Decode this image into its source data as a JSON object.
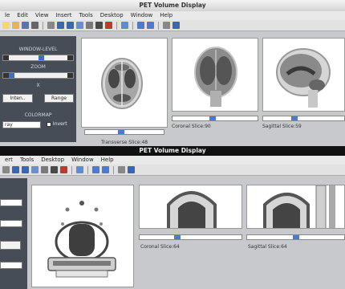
{
  "window1": {
    "title": "PET Volume Display",
    "menu": [
      "le",
      "Edit",
      "View",
      "Insert",
      "Tools",
      "Desktop",
      "Window",
      "Help"
    ],
    "panel": {
      "window_level_label": "WINDOW-LEVEL",
      "zoom_label": "ZOOM",
      "x_label": "X",
      "interp_button": "Inten..",
      "range_button": "Range",
      "colormap_label": "COLORMAP",
      "colormap_value": "ray",
      "invert_label": "Invert"
    },
    "views": {
      "transverse_label": "Transverse Slice:48",
      "coronal_label": "Coronal Slice:90",
      "sagittal_label": "Sagittal Slice:59"
    }
  },
  "window2": {
    "title": "PET Volume Display",
    "menu": [
      "ert",
      "Tools",
      "Desktop",
      "Window",
      "Help"
    ],
    "views": {
      "coronal_label": "Coronal Slice:64",
      "sagittal_label": "Sagittal Slice:64"
    }
  },
  "colors": {
    "panel_bg": "#474d57",
    "window_bg": "#c7c9cc",
    "slider_thumb": "#3c6cc4"
  },
  "slider_levels": {
    "transverse": 0.45,
    "coronal": 0.47,
    "sagittal": 0.38,
    "coronal2": 0.36,
    "sagittal2": 0.5,
    "window_level": 0.5,
    "zoom": 0.08
  }
}
